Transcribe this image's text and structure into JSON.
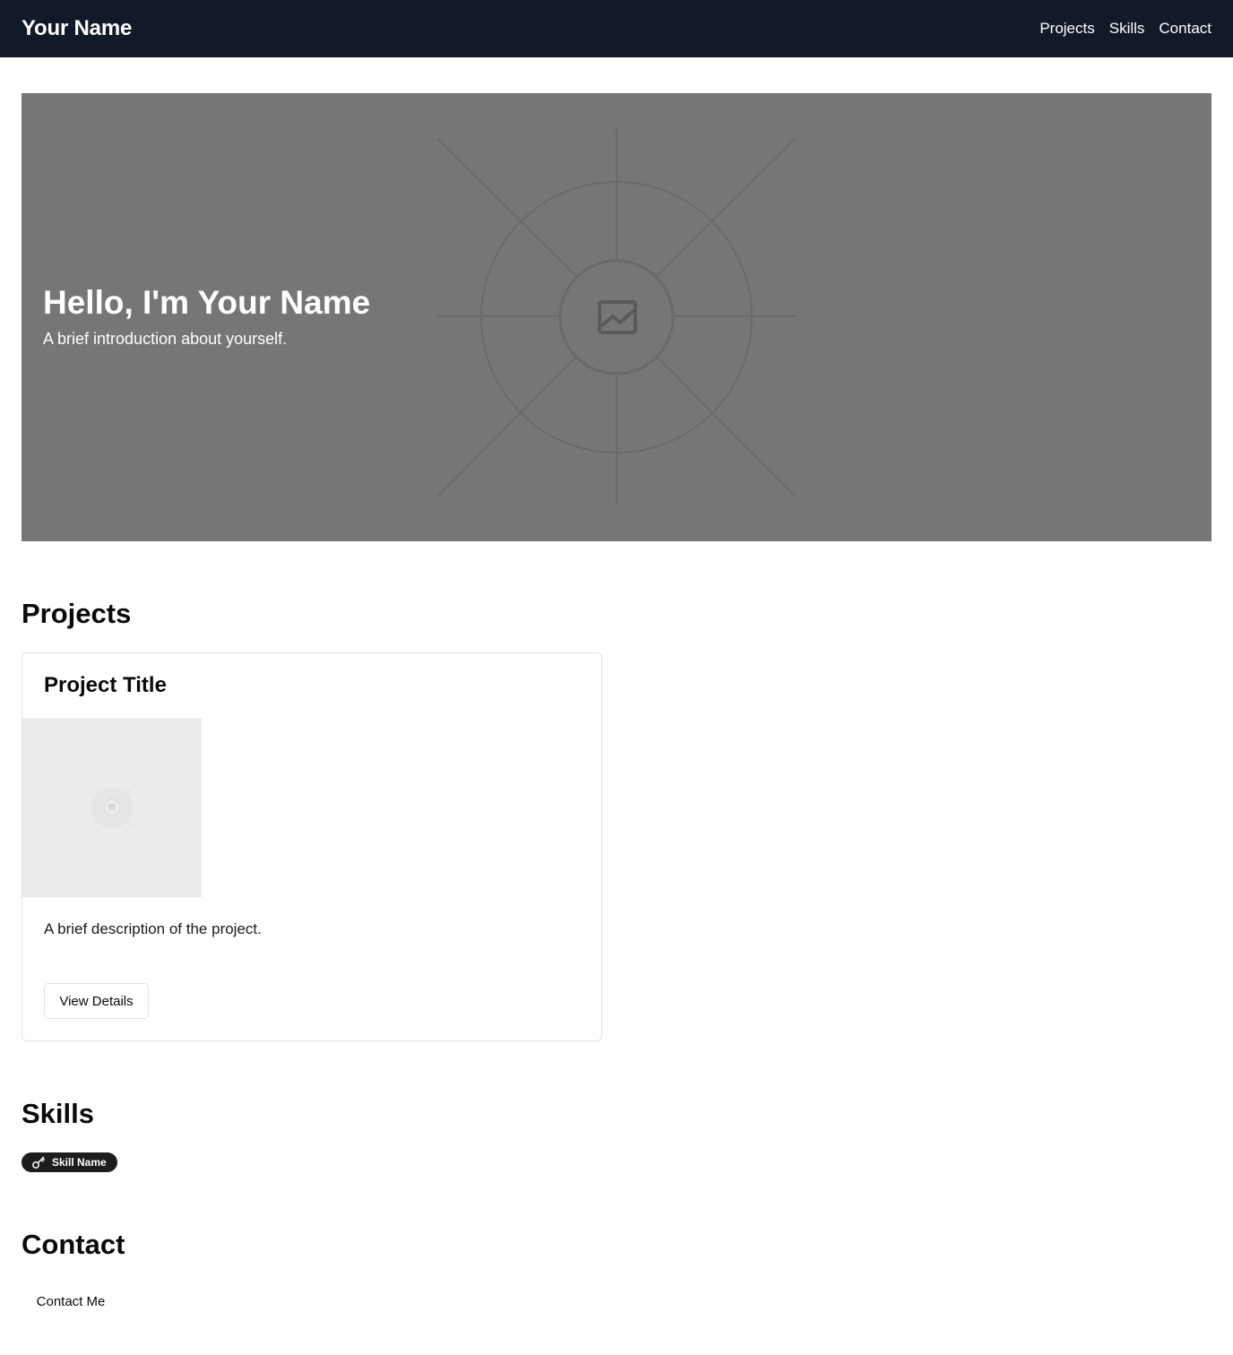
{
  "navbar": {
    "brand": "Your Name",
    "links": [
      "Projects",
      "Skills",
      "Contact"
    ]
  },
  "hero": {
    "title": "Hello, I'm Your Name",
    "subtitle": "A brief introduction about yourself.",
    "background_color": "#767676",
    "image_placeholder_icon": "image-placeholder-icon"
  },
  "projects": {
    "heading": "Projects",
    "cards": [
      {
        "title": "Project Title",
        "description": "A brief description of the project.",
        "button_label": "View Details",
        "image_placeholder_icon": "image-placeholder-icon"
      }
    ]
  },
  "skills": {
    "heading": "Skills",
    "items": [
      {
        "label": "Skill Name",
        "icon": "key-icon"
      }
    ]
  },
  "contact": {
    "heading": "Contact",
    "button_label": "Contact Me"
  },
  "colors": {
    "navbar_bg": "#121929",
    "badge_bg": "#1d1d1d",
    "card_border": "#e4e4e4"
  }
}
